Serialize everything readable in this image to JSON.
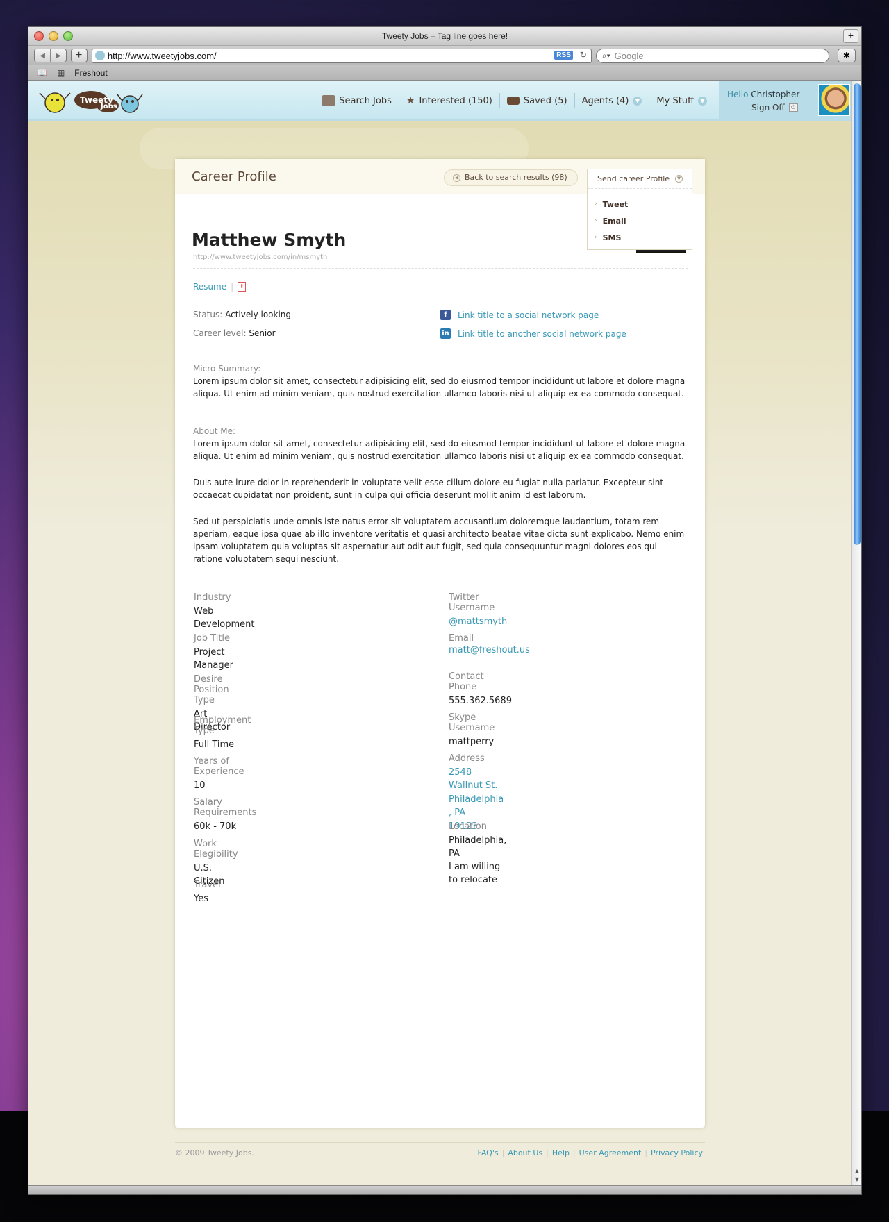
{
  "window": {
    "title": "Tweety Jobs – Tag line goes here!"
  },
  "browser": {
    "url": "http://www.tweetyjobs.com/",
    "rss_label": "RSS",
    "search_placeholder": "Google",
    "bookmark": "Freshout"
  },
  "site": {
    "logo_text_1": "Tweety",
    "logo_text_2": "Jobs",
    "nav": [
      {
        "label": "Search Jobs",
        "icon": "newspaper-icon"
      },
      {
        "label": "Interested (150)",
        "icon": "star-icon"
      },
      {
        "label": "Saved (5)",
        "icon": "bag-icon"
      },
      {
        "label": "Agents (4)",
        "icon": "chevron-down-icon"
      },
      {
        "label": "My Stuff",
        "icon": "chevron-down-icon"
      }
    ],
    "user": {
      "hello": "Hello",
      "name": "Christopher",
      "signoff": "Sign Off"
    }
  },
  "profile": {
    "header_title": "Career Profile",
    "back_label": "Back to search results (98)",
    "send_label": "Send career Profile",
    "send_options": [
      "Tweet",
      "Email",
      "SMS"
    ],
    "name": "Matthew Smyth",
    "url": "http://www.tweetyjobs.com/in/msmyth",
    "resume_label": "Resume",
    "status_label": "Status:",
    "status_value": "Actively looking",
    "career_label": "Career level:",
    "career_value": "Senior",
    "social_1": "Link title to a social network page",
    "social_2": "Link title to another social network page",
    "micro_label": "Micro Summary:",
    "micro_text": "Lorem ipsum dolor sit amet, consectetur adipisicing elit, sed do eiusmod tempor incididunt ut labore et dolore magna aliqua. Ut enim ad minim veniam, quis nostrud exercitation ullamco laboris nisi ut aliquip ex ea commodo consequat.",
    "about_label": "About Me:",
    "about_paragraphs": [
      "Lorem ipsum dolor sit amet, consectetur adipisicing elit, sed do eiusmod tempor incididunt ut labore et dolore magna aliqua. Ut enim ad minim veniam, quis nostrud exercitation ullamco laboris nisi ut aliquip ex ea commodo consequat.",
      "Duis aute irure dolor in reprehenderit in voluptate velit esse cillum dolore eu fugiat nulla pariatur. Excepteur sint occaecat cupidatat non proident, sunt in culpa qui officia deserunt mollit anim id est laborum.",
      "Sed ut perspiciatis unde omnis iste natus error sit voluptatem accusantium doloremque laudantium, totam rem aperiam, eaque ipsa quae ab illo inventore veritatis et quasi architecto beatae vitae dicta sunt explicabo. Nemo enim ipsam voluptatem quia voluptas sit aspernatur aut odit aut fugit, sed quia consequuntur magni dolores eos qui ratione voluptatem sequi nesciunt."
    ],
    "left_fields": [
      {
        "label": "Industry",
        "value": "Web Development"
      },
      {
        "label": "Job Title",
        "value": "Project Manager"
      },
      {
        "label": "Desire Position Type",
        "value": "Art Director"
      },
      {
        "label": "Employment Type",
        "value": "Full Time"
      },
      {
        "label": "Years of Experience",
        "value": "10"
      },
      {
        "label": "Salary Requirements",
        "value": "60k - 70k"
      },
      {
        "label": "Work Elegibility",
        "value": "U.S. Citizen"
      },
      {
        "label": "Travel",
        "value": "Yes"
      }
    ],
    "twitter_label": "Twitter Username",
    "twitter_value": "@mattsmyth",
    "email_label": "Email",
    "email_value": "matt@freshout.us",
    "phone_label": "Contact Phone",
    "phone_value": "555.362.5689",
    "skype_label": "Skype Username",
    "skype_value": "mattperry",
    "address_label": "Address",
    "address_line1": "2548 Wallnut St.",
    "address_line2": "Philadelphia , PA",
    "address_line3": "19123",
    "location_label": "Location",
    "location_value": "Philadelphia, PA",
    "relocate_value": "I am willing to relocate"
  },
  "footer": {
    "copyright": "© 2009 Tweety Jobs.",
    "links": [
      "FAQ's",
      "About Us",
      "Help",
      "User Agreement",
      "Privacy Policy"
    ]
  },
  "colors": {
    "link": "#3a99b5",
    "header_bg": "#c7e7f0",
    "content_bg": "#efecdc"
  }
}
